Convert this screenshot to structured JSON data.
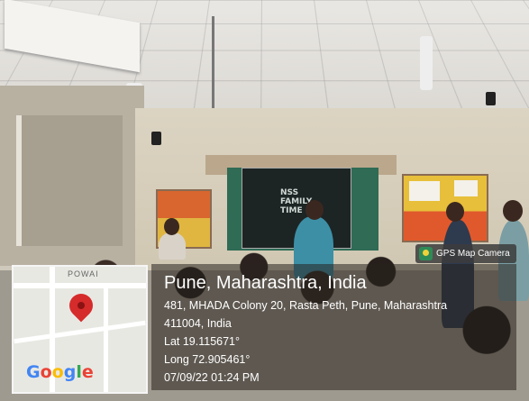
{
  "photo": {
    "screen_text": [
      "NSS",
      "FAMILY",
      "TIME"
    ]
  },
  "overlay": {
    "badge_label": "GPS Map Camera",
    "badge_icon": "gps-map-camera-icon",
    "map_street_label": "POWAI",
    "map_logo": "Google",
    "location_title": "Pune, Maharashtra, India",
    "address_line1": "481, MHADA Colony 20, Rasta Peth, Pune, Maharashtra",
    "address_line2": "411004, India",
    "lat": "Lat 19.115671°",
    "long": "Long 72.905461°",
    "datetime": "07/09/22 01:24 PM",
    "colors": {
      "pin": "#d62b2b",
      "google_blue": "#4285f4",
      "google_red": "#ea4335",
      "google_yellow": "#fbbc05",
      "google_green": "#34a853"
    }
  }
}
